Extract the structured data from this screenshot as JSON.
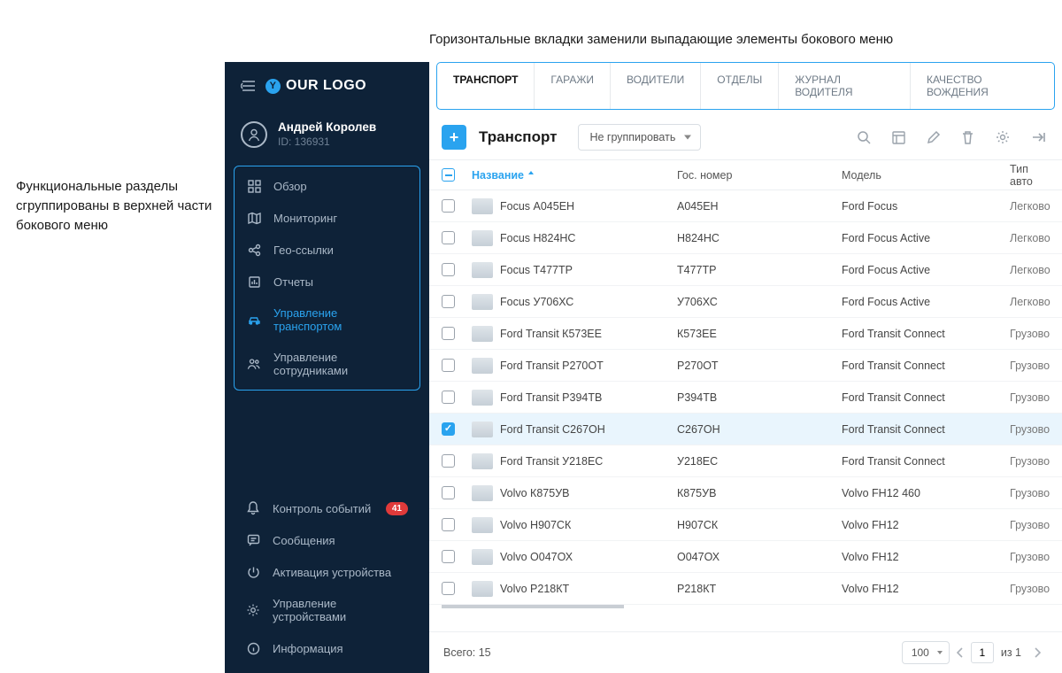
{
  "annotations": {
    "top": "Горизонтальные вкладки заменили выпадающие элементы бокового меню",
    "left": "Функциональные разделы сгруппированы в верхней части бокового меню"
  },
  "sidebar": {
    "logo_letter": "Y",
    "logo_text": "OUR LOGO",
    "user_name": "Андрей Королев",
    "user_id": "ID: 136931",
    "nav_primary": [
      {
        "label": "Обзор",
        "icon": "grid-icon"
      },
      {
        "label": "Мониторинг",
        "icon": "map-icon"
      },
      {
        "label": "Гео-ссылки",
        "icon": "share-icon"
      },
      {
        "label": "Отчеты",
        "icon": "report-icon"
      },
      {
        "label": "Управление транспортом",
        "icon": "car-icon",
        "selected": true
      },
      {
        "label": "Управление сотрудниками",
        "icon": "people-icon"
      }
    ],
    "nav_secondary": [
      {
        "label": "Контроль событий",
        "icon": "bell-icon",
        "badge": "41"
      },
      {
        "label": "Сообщения",
        "icon": "message-icon"
      },
      {
        "label": "Активация устройства",
        "icon": "power-icon"
      },
      {
        "label": "Управление устройствами",
        "icon": "gear-icon"
      },
      {
        "label": "Информация",
        "icon": "info-icon"
      }
    ]
  },
  "tabs": [
    "ТРАНСПОРТ",
    "ГАРАЖИ",
    "ВОДИТЕЛИ",
    "ОТДЕЛЫ",
    "ЖУРНАЛ ВОДИТЕЛЯ",
    "КАЧЕСТВО ВОЖДЕНИЯ"
  ],
  "active_tab": 0,
  "toolbar": {
    "title": "Транспорт",
    "group_by": "Не группировать"
  },
  "table": {
    "headers": {
      "name": "Название",
      "plate": "Гос. номер",
      "model": "Модель",
      "type": "Тип авто"
    },
    "rows": [
      {
        "name": "Focus А045ЕН",
        "plate": "А045ЕН",
        "model": "Ford Focus",
        "type": "Легково"
      },
      {
        "name": "Focus Н824НС",
        "plate": "Н824НС",
        "model": "Ford Focus Active",
        "type": "Легково"
      },
      {
        "name": "Focus Т477ТР",
        "plate": "Т477ТР",
        "model": "Ford Focus Active",
        "type": "Легково"
      },
      {
        "name": "Focus У706ХС",
        "plate": "У706ХС",
        "model": "Ford Focus Active",
        "type": "Легково"
      },
      {
        "name": "Ford Transit К573ЕЕ",
        "plate": "К573ЕЕ",
        "model": "Ford Transit Connect",
        "type": "Грузово"
      },
      {
        "name": "Ford Transit Р270ОТ",
        "plate": "Р270ОТ",
        "model": "Ford Transit Connect",
        "type": "Грузово"
      },
      {
        "name": "Ford Transit Р394ТВ",
        "plate": "Р394ТВ",
        "model": "Ford Transit Connect",
        "type": "Грузово"
      },
      {
        "name": "Ford Transit С267ОН",
        "plate": "С267ОН",
        "model": "Ford Transit Connect",
        "type": "Грузово",
        "selected": true
      },
      {
        "name": "Ford Transit У218ЕС",
        "plate": "У218ЕС",
        "model": "Ford Transit Connect",
        "type": "Грузово"
      },
      {
        "name": "Volvo К875УВ",
        "plate": "К875УВ",
        "model": "Volvo FH12 460",
        "type": "Грузово"
      },
      {
        "name": "Volvo Н907СК",
        "plate": "Н907СК",
        "model": "Volvo FH12",
        "type": "Грузово"
      },
      {
        "name": "Volvo О047ОХ",
        "plate": "О047ОХ",
        "model": "Volvo FH12",
        "type": "Грузово"
      },
      {
        "name": "Volvo Р218КТ",
        "plate": "Р218КТ",
        "model": "Volvo FH12",
        "type": "Грузово"
      }
    ]
  },
  "footer": {
    "total_label": "Всего: 15",
    "page_size": "100",
    "page": "1",
    "of_label": "из 1"
  }
}
